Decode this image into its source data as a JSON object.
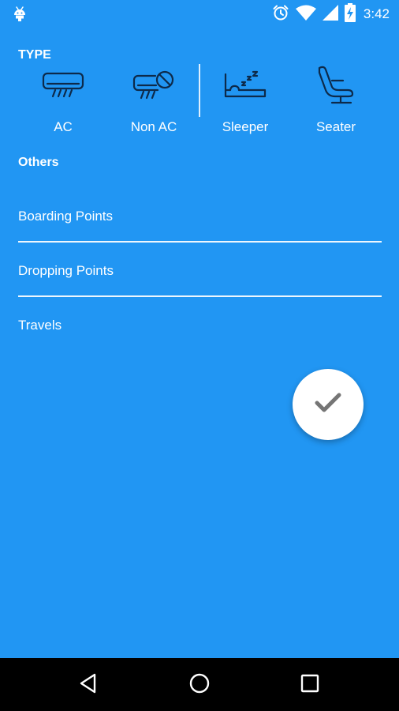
{
  "status_bar": {
    "time": "3:42",
    "icons": [
      "android-icon",
      "alarm-icon",
      "wifi-icon",
      "signal-icon",
      "battery-charging-icon"
    ]
  },
  "filters": {
    "type_title": "TYPE",
    "types": [
      {
        "label": "AC",
        "icon": "ac-icon"
      },
      {
        "label": "Non AC",
        "icon": "non-ac-icon"
      },
      {
        "label": "Sleeper",
        "icon": "sleeper-icon"
      },
      {
        "label": "Seater",
        "icon": "seater-icon"
      }
    ],
    "others_title": "Others",
    "fields": [
      {
        "label": "Boarding Points"
      },
      {
        "label": "Dropping Points"
      },
      {
        "label": "Travels"
      }
    ]
  },
  "fab": {
    "icon": "check-icon"
  },
  "nav_bar": {
    "icons": [
      "back-icon",
      "home-icon",
      "recents-icon"
    ]
  },
  "colors": {
    "background": "#2196F3",
    "icon_stroke": "#0D2A4A",
    "text": "#FFFFFF",
    "fab_background": "#FFFFFF",
    "fab_icon": "#757575",
    "nav_background": "#000000"
  }
}
